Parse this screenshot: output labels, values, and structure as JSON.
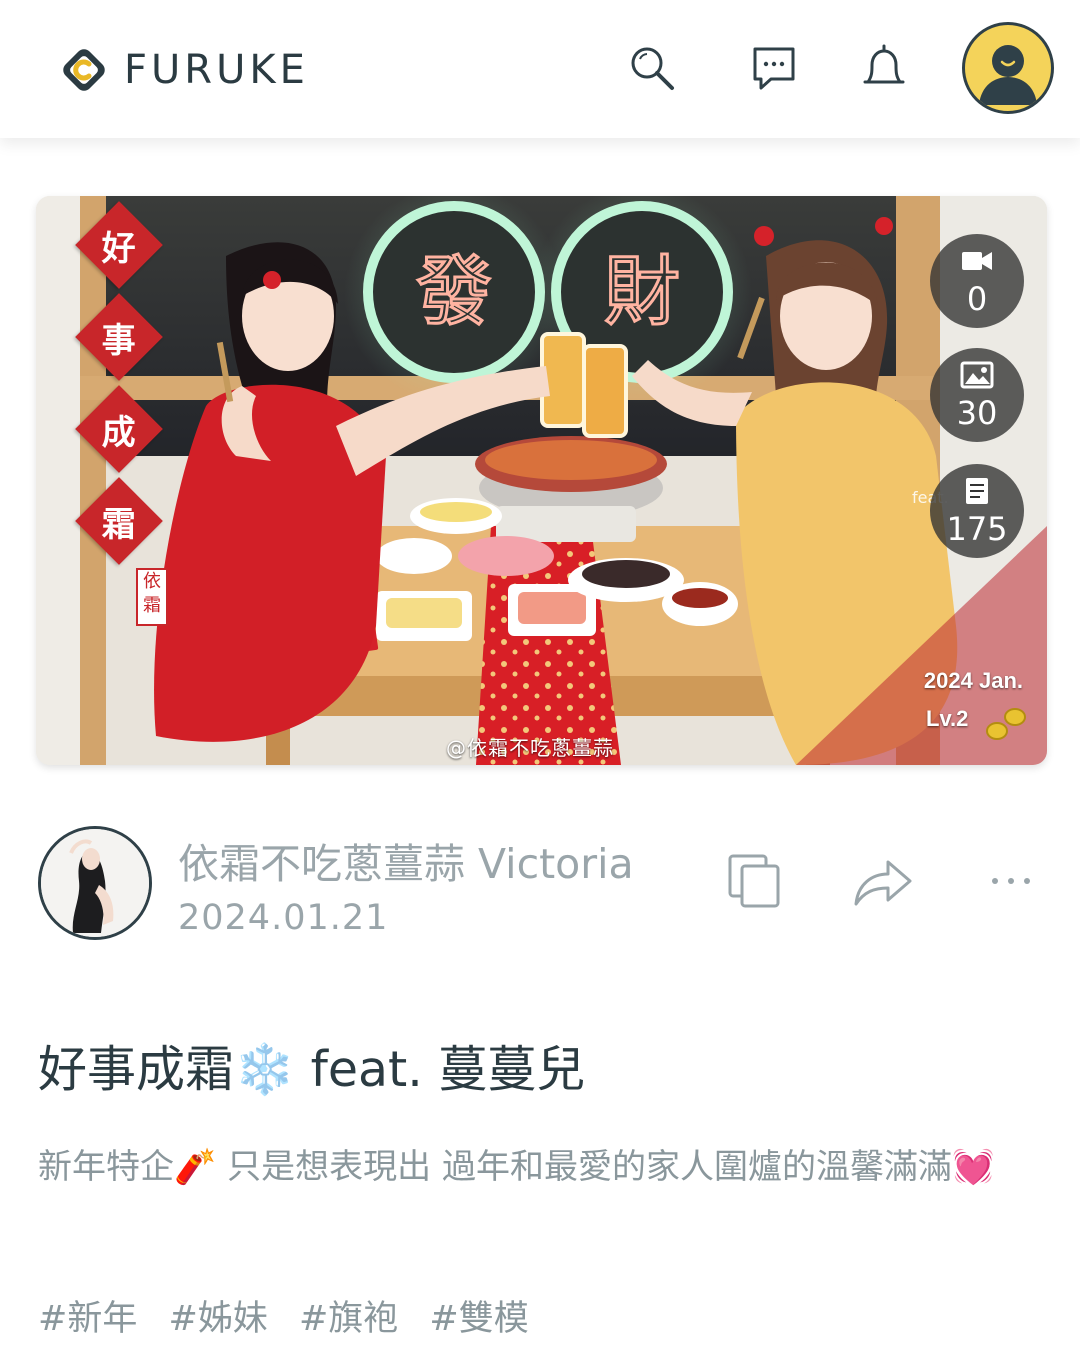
{
  "header": {
    "logo_text": "FURUKE",
    "icons": [
      "search-icon",
      "chat-icon",
      "bell-icon",
      "avatar-icon"
    ]
  },
  "hero": {
    "vertical_text": [
      "好",
      "事",
      "成",
      "霜"
    ],
    "seal_text": "依霜",
    "neon_signs": [
      "發",
      "財"
    ],
    "watermark": "@依霜不吃蔥薑蒜",
    "corner_date": "2024 Jan.",
    "level": "Lv.2",
    "side_text": "feat.",
    "stats": [
      {
        "icon": "video-icon",
        "value": "0"
      },
      {
        "icon": "image-icon",
        "value": "30"
      },
      {
        "icon": "post-icon",
        "value": "175"
      }
    ]
  },
  "author": {
    "name": "依霜不吃蔥薑蒜 Victoria",
    "date": "2024.01.21"
  },
  "actions": [
    "copy-icon",
    "share-icon",
    "more-icon"
  ],
  "post": {
    "title": "好事成霜❄️ feat. 蔓蔓兒",
    "description": "新年特企🧨 只是想表現出 過年和最愛的家人圍爐的溫馨滿滿💓",
    "tags": [
      "#新年",
      "#姊妹",
      "#旗袍",
      "#雙模"
    ]
  },
  "colors": {
    "accent_dark": "#2f4048",
    "avatar_yellow": "#f4d35a",
    "muted_text": "#9aa5aa",
    "red": "#c8262a"
  }
}
